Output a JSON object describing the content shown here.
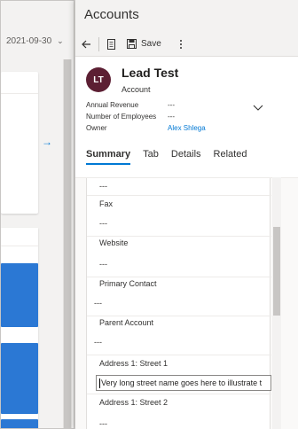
{
  "background": {
    "date_filter": "2021-09-30"
  },
  "panel": {
    "title": "Accounts"
  },
  "toolbar": {
    "back_icon": "back-arrow-icon",
    "record_icon": "record-icon",
    "save_label": "Save",
    "more_icon": "more-vertical-icon"
  },
  "record": {
    "initials": "LT",
    "avatar_color": "#5c1f33",
    "name": "Lead Test",
    "entity": "Account",
    "header_fields": [
      {
        "label": "Annual Revenue",
        "value": "---"
      },
      {
        "label": "Number of Employees",
        "value": "---"
      },
      {
        "label": "Owner",
        "value": "Alex Shlega"
      }
    ]
  },
  "tabs": [
    {
      "label": "Summary",
      "active": true
    },
    {
      "label": "Tab",
      "active": false
    },
    {
      "label": "Details",
      "active": false
    },
    {
      "label": "Related",
      "active": false
    }
  ],
  "form": {
    "top_value": "---",
    "fax_label": "Fax",
    "fax_value": "---",
    "website_label": "Website",
    "website_value": "---",
    "primary_contact_label": "Primary Contact",
    "primary_contact_value": "---",
    "parent_account_label": "Parent Account",
    "parent_account_value": "---",
    "street1_label": "Address 1: Street 1",
    "street1_value": "Very long street name goes here to illustrate t",
    "street2_label": "Address 1: Street 2",
    "street2_value": "---"
  },
  "colors": {
    "accent": "#0078d4",
    "tile_blue": "#2b78d4"
  }
}
